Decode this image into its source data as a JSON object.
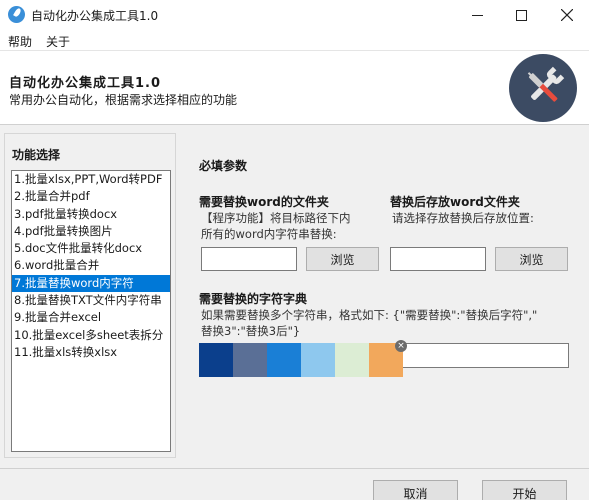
{
  "window": {
    "title": "自动化办公集成工具1.0",
    "app_icon": "feather-icon"
  },
  "menu": {
    "items": [
      "帮助",
      "关于"
    ]
  },
  "header": {
    "title": "自动化办公集成工具1.0",
    "subtitle": "常用办公自动化，根据需求选择相应的功能",
    "logo_icon": "tools-icon"
  },
  "sidebar": {
    "title": "功能选择",
    "selected_index": 6,
    "items": [
      "1.批量xlsx,PPT,Word转PDF",
      "2.批量合并pdf",
      "3.pdf批量转换docx",
      "4.pdf批量转换图片",
      "5.doc文件批量转化docx",
      "6.word批量合并",
      "7.批量替换word内字符",
      "8.批量替换TXT文件内字符串",
      "9.批量合并excel",
      "10.批量excel多sheet表拆分",
      "11.批量xls转换xlsx"
    ]
  },
  "form": {
    "section_title": "必填参数",
    "source_folder": {
      "label": "需要替换word的文件夹",
      "desc_line1": "【程序功能】将目标路径下内",
      "desc_line2": "所有的word内字符串替换:",
      "value": "",
      "browse_label": "浏览"
    },
    "target_folder": {
      "label": "替换后存放word文件夹",
      "desc": "请选择存放替换后存放位置:",
      "value": "",
      "browse_label": "浏览"
    },
    "dict": {
      "label": "需要替换的字符字典",
      "desc_line1": "如果需要替换多个字符串，格式如下: {\"需要替换\":\"替换后字符\",\"",
      "desc_line2": "替换3\":\"替换3后\"}",
      "value": "",
      "swatch_colors": [
        "#0b3f8c",
        "#5a6f96",
        "#1a7fd6",
        "#8ec8ee",
        "#dcedd4",
        "#f2a85c"
      ]
    }
  },
  "footer": {
    "cancel_label": "取消",
    "start_label": "开始"
  }
}
